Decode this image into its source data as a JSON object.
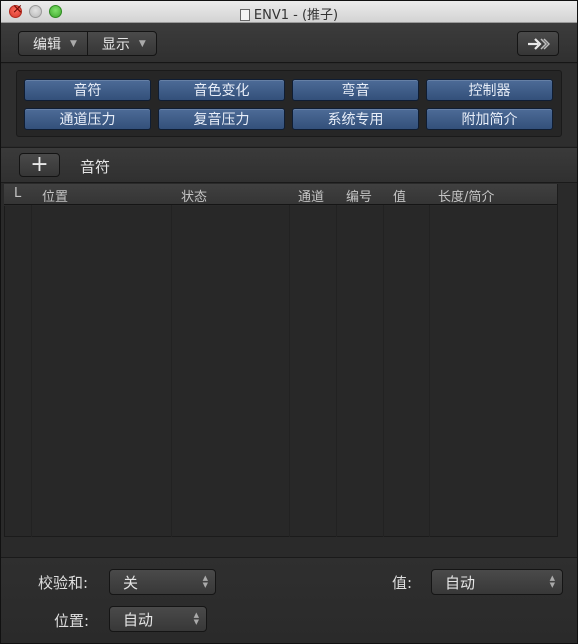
{
  "window": {
    "title": "ENV1 - (推子)"
  },
  "toolbar": {
    "edit_label": "编辑",
    "view_label": "显示",
    "catch_icon": "catch-arrow-icon"
  },
  "filters": [
    {
      "label": "音符"
    },
    {
      "label": "音色变化"
    },
    {
      "label": "弯音"
    },
    {
      "label": "控制器"
    },
    {
      "label": "通道压力"
    },
    {
      "label": "复音压力"
    },
    {
      "label": "系统专用"
    },
    {
      "label": "附加简介"
    }
  ],
  "create": {
    "plus": "+",
    "label": "音符"
  },
  "columns": [
    "L",
    "位置",
    "状态",
    "通道",
    "编号",
    "值",
    "长度/简介"
  ],
  "footer": {
    "checksum_label": "校验和:",
    "checksum_value": "关",
    "position_label": "位置:",
    "position_value": "自动",
    "value_label": "值:",
    "value_value": "自动"
  },
  "colors": {
    "filter_button": "#3f5d88",
    "background": "#2a2a2a"
  }
}
